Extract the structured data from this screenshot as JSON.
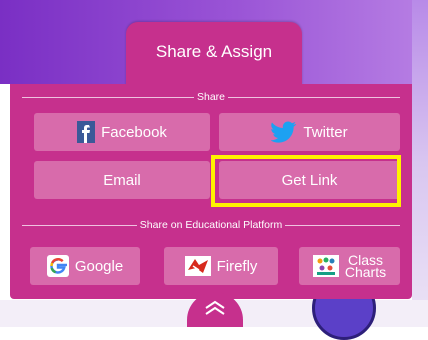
{
  "tab": {
    "label": "Share & Assign"
  },
  "sections": {
    "share_label": "Share",
    "platform_label": "Share on Educational Platform"
  },
  "buttons": {
    "facebook": "Facebook",
    "twitter": "Twitter",
    "email": "Email",
    "get_link": "Get Link",
    "google": "Google",
    "firefly": "Firefly",
    "class_charts_line1": "Class",
    "class_charts_line2": "Charts"
  },
  "colors": {
    "panel": "#c6308d",
    "button": "#d86bab",
    "highlight": "#fff200",
    "header_gradient_start": "#7a2fc4"
  },
  "icons": {
    "facebook": "facebook-icon",
    "twitter": "twitter-icon",
    "google": "google-icon",
    "firefly": "firefly-icon",
    "class_charts": "class-charts-icon",
    "expand": "chevron-up-icon"
  }
}
